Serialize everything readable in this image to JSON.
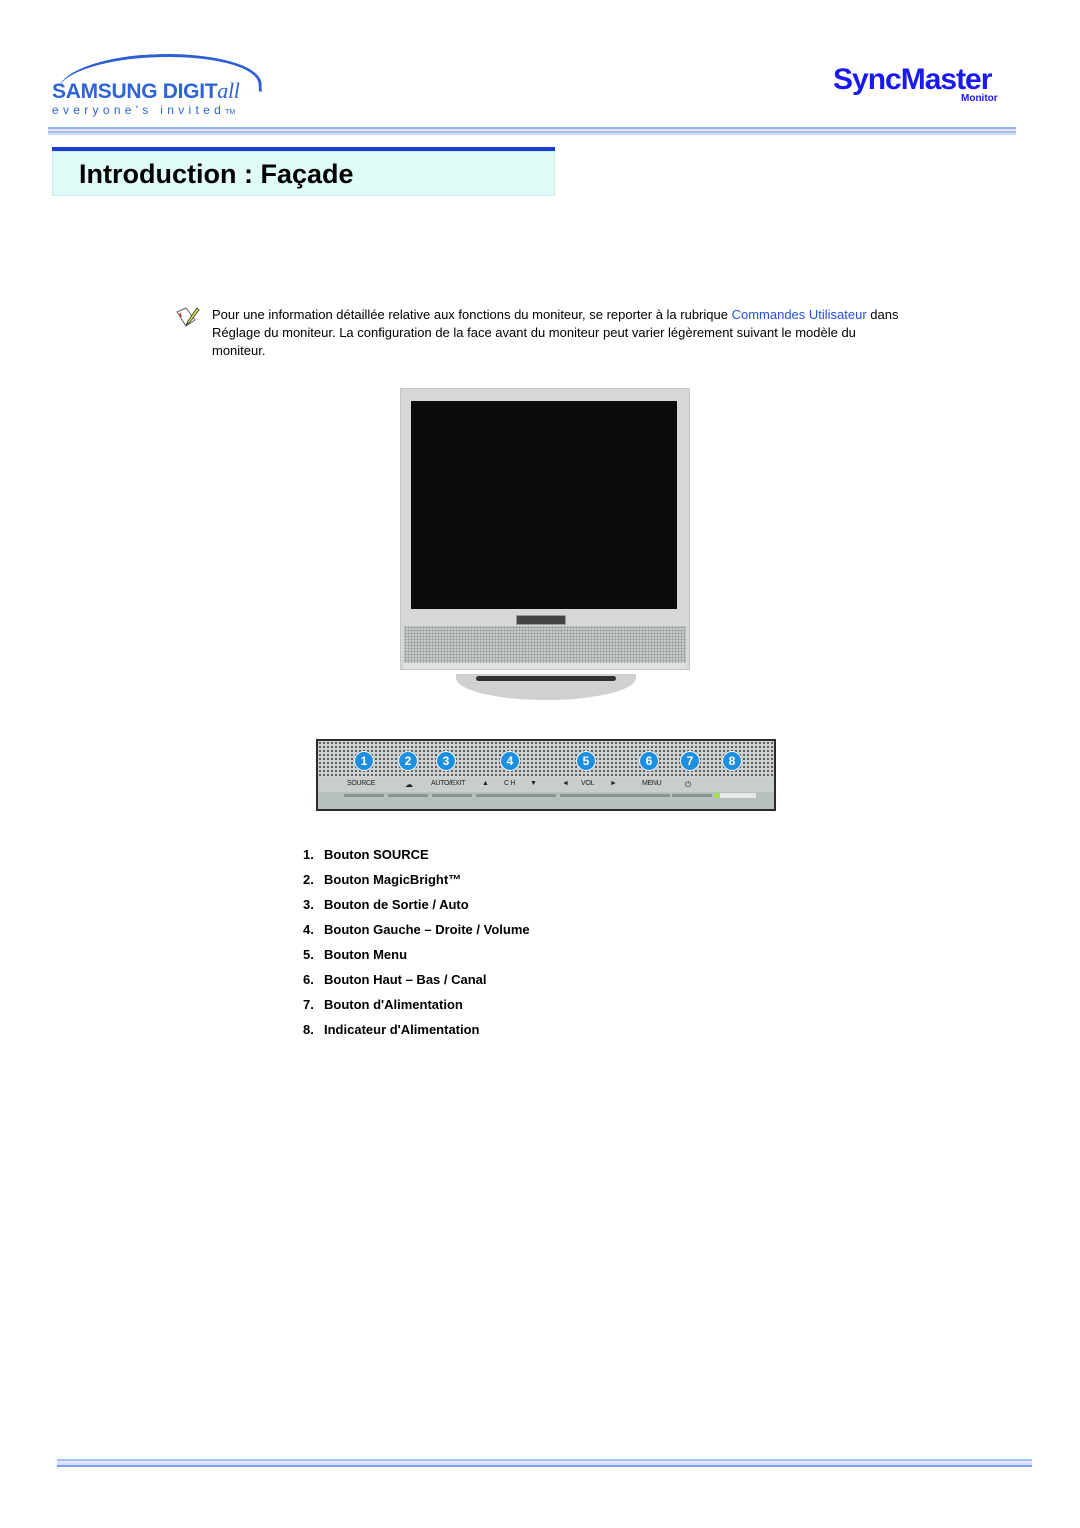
{
  "header": {
    "brand_name": "SAMSUNG DIGIT",
    "brand_suffix": "all",
    "brand_tagline": "everyone's invited",
    "brand_tm": "TM",
    "product_name": "SyncMaster",
    "product_sub": "Monitor"
  },
  "page": {
    "title": "Introduction : Façade"
  },
  "note": {
    "icon": "note-pencil-icon",
    "text_before": "Pour une information détaillée relative aux fonctions du moniteur, se reporter à la rubrique ",
    "link_text": "Commandes Utilisateur",
    "text_after": " dans Réglage du moniteur. La configuration de la face avant du moniteur peut varier légèrement suivant le modèle du moniteur.",
    "link_color": "#2450e0"
  },
  "figure": {
    "monitor_image": "monitor-front-photo",
    "panel": {
      "numbers": [
        "1",
        "2",
        "3",
        "4",
        "5",
        "6",
        "7",
        "8"
      ],
      "labels": {
        "source": "SOURCE",
        "autoexit": "AUTO/EXIT",
        "up": "▲",
        "ch": "C H",
        "down": "▼",
        "left": "◄",
        "vol": "VOL",
        "right": "►",
        "menu": "MENU",
        "power": "⏻"
      },
      "number_color": "#1d8fe0",
      "led_color": "#9fe04a"
    }
  },
  "legend": [
    {
      "num": "1.",
      "label": "Bouton SOURCE"
    },
    {
      "num": "2.",
      "label": "Bouton MagicBright™"
    },
    {
      "num": "3.",
      "label": "Bouton de Sortie / Auto"
    },
    {
      "num": "4.",
      "label": "Bouton Gauche – Droite / Volume"
    },
    {
      "num": "5.",
      "label": "Bouton Menu"
    },
    {
      "num": "6.",
      "label": "Bouton Haut – Bas / Canal"
    },
    {
      "num": "7.",
      "label": "Bouton d'Alimentation"
    },
    {
      "num": "8.",
      "label": "Indicateur d'Alimentation"
    }
  ],
  "colors": {
    "title_bar": "#1a3fd0",
    "title_bg": "#e0fcf8",
    "brand_blue": "#2f63d8",
    "syncmaster_blue": "#1a1af0"
  }
}
